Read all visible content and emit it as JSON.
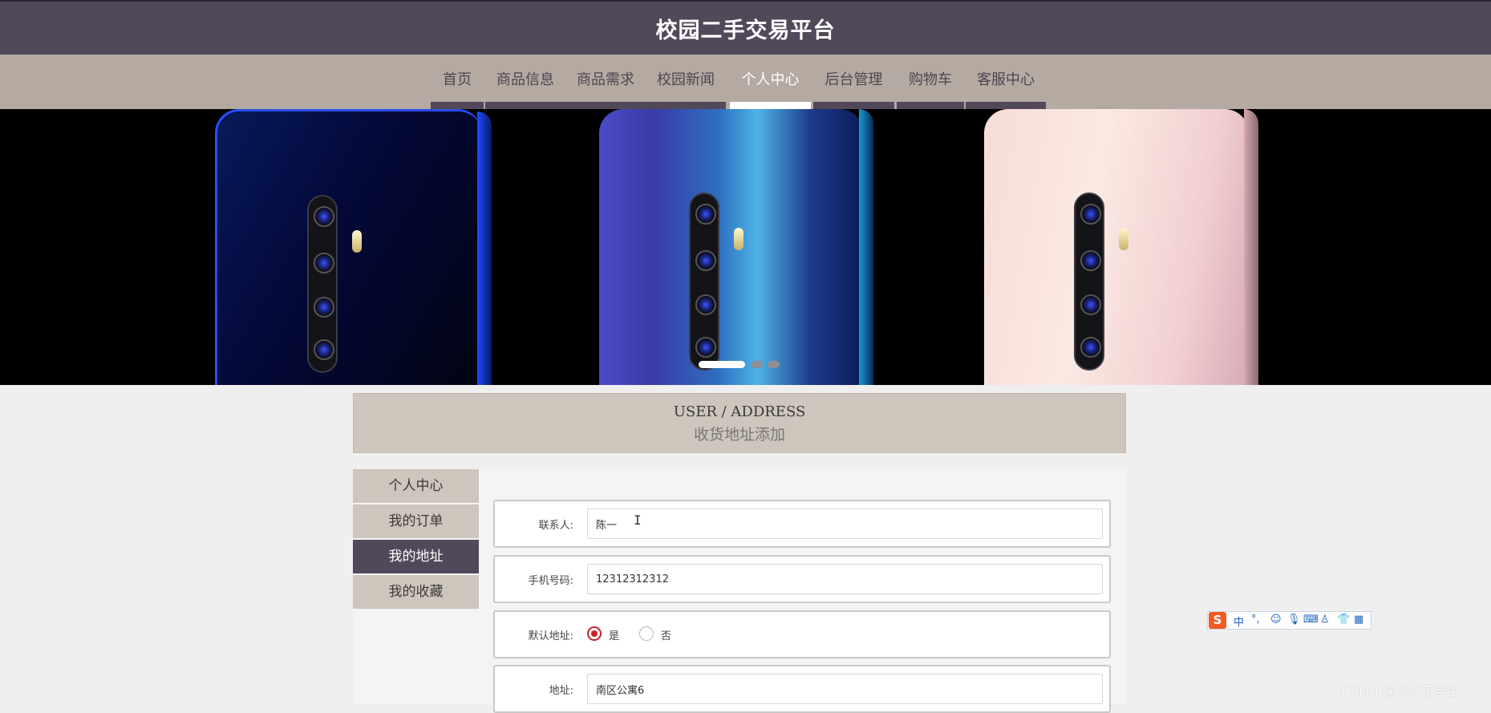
{
  "header": {
    "title": "校园二手交易平台"
  },
  "nav": {
    "items": [
      {
        "label": "首页"
      },
      {
        "label": "商品信息"
      },
      {
        "label": "商品需求"
      },
      {
        "label": "校园新闻"
      },
      {
        "label": "个人中心"
      },
      {
        "label": "后台管理"
      },
      {
        "label": "购物车"
      },
      {
        "label": "客服中心"
      }
    ],
    "active_label": "个人中心"
  },
  "banner": {
    "slide_count": 3,
    "active_slide": 1
  },
  "page_heading": {
    "en": "USER / ADDRESS",
    "cn": "收货地址添加"
  },
  "sidebar": {
    "items": [
      {
        "label": "个人中心"
      },
      {
        "label": "我的订单"
      },
      {
        "label": "我的地址"
      },
      {
        "label": "我的收藏"
      }
    ],
    "active_label": "我的地址"
  },
  "form": {
    "contact": {
      "label": "联系人:",
      "value": "陈一"
    },
    "phone": {
      "label": "手机号码:",
      "value": "12312312312"
    },
    "default_address": {
      "label": "默认地址:",
      "options": [
        {
          "label": "是",
          "checked": true
        },
        {
          "label": "否",
          "checked": false
        }
      ]
    },
    "address": {
      "label": "地址:",
      "value": "南区公寓6"
    }
  },
  "ime_toolbar": {
    "logo": "S",
    "mode": "中",
    "punct": "°,"
  },
  "watermark": "CSDN @小小花学姐",
  "colors": {
    "header_bg": "#51495a",
    "nav_bg": "#b5aaa1",
    "panel_bg": "#cec5bc",
    "accent_red": "#c8232c"
  }
}
